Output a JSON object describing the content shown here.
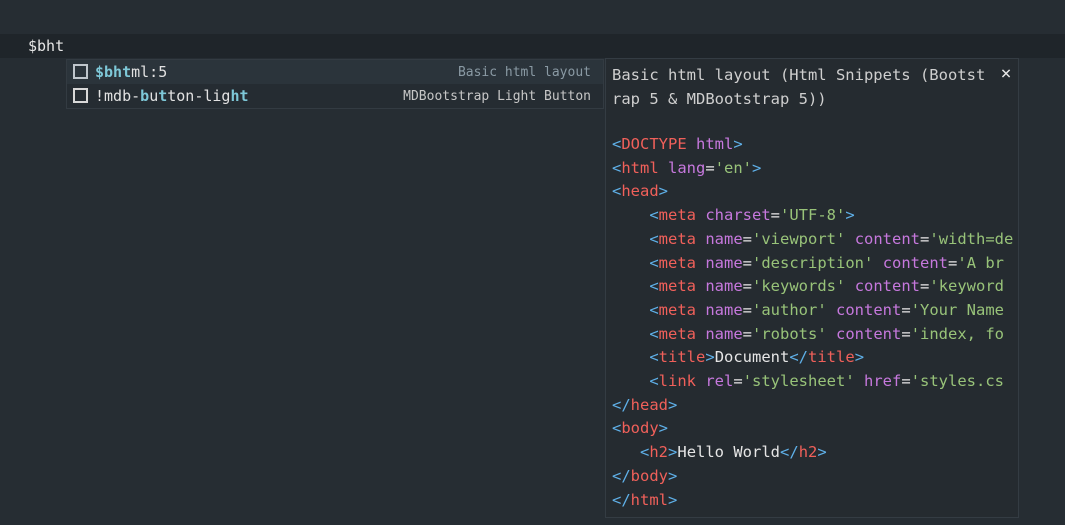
{
  "editor": {
    "text": "$bht"
  },
  "suggestions": [
    {
      "label_match": "$bht",
      "label_rest": "ml:5",
      "detail": "Basic html layout"
    },
    {
      "label_pre": "!mdb-",
      "label_match_1": "b",
      "label_mid": "u",
      "label_match_2": "t",
      "label_mid2": "ton-lig",
      "label_match_3": "ht",
      "detail": "MDBootstrap Light Button"
    }
  ],
  "doc": {
    "title": "Basic html layout (Html Snippets (Bootstrap 5 & MDBootstrap 5))",
    "close_label": "×"
  },
  "code_lines": [
    [
      [
        "p",
        "<"
      ],
      [
        "t",
        "DOCTYPE"
      ],
      [
        "x",
        " "
      ],
      [
        "a",
        "html"
      ],
      [
        "p",
        ">"
      ]
    ],
    [
      [
        "p",
        "<"
      ],
      [
        "t",
        "html"
      ],
      [
        "x",
        " "
      ],
      [
        "a",
        "lang"
      ],
      [
        "x",
        "="
      ],
      [
        "s",
        "'en'"
      ],
      [
        "p",
        ">"
      ]
    ],
    [
      [
        "p",
        "<"
      ],
      [
        "t",
        "head"
      ],
      [
        "p",
        ">"
      ]
    ],
    [
      [
        "x",
        "    "
      ],
      [
        "p",
        "<"
      ],
      [
        "t",
        "meta"
      ],
      [
        "x",
        " "
      ],
      [
        "a",
        "charset"
      ],
      [
        "x",
        "="
      ],
      [
        "s",
        "'UTF-8'"
      ],
      [
        "p",
        ">"
      ]
    ],
    [
      [
        "x",
        "    "
      ],
      [
        "p",
        "<"
      ],
      [
        "t",
        "meta"
      ],
      [
        "x",
        " "
      ],
      [
        "a",
        "name"
      ],
      [
        "x",
        "="
      ],
      [
        "s",
        "'viewport'"
      ],
      [
        "x",
        " "
      ],
      [
        "a",
        "content"
      ],
      [
        "x",
        "="
      ],
      [
        "s",
        "'width=de"
      ]
    ],
    [
      [
        "x",
        "    "
      ],
      [
        "p",
        "<"
      ],
      [
        "t",
        "meta"
      ],
      [
        "x",
        " "
      ],
      [
        "a",
        "name"
      ],
      [
        "x",
        "="
      ],
      [
        "s",
        "'description'"
      ],
      [
        "x",
        " "
      ],
      [
        "a",
        "content"
      ],
      [
        "x",
        "="
      ],
      [
        "s",
        "'A br"
      ]
    ],
    [
      [
        "x",
        "    "
      ],
      [
        "p",
        "<"
      ],
      [
        "t",
        "meta"
      ],
      [
        "x",
        " "
      ],
      [
        "a",
        "name"
      ],
      [
        "x",
        "="
      ],
      [
        "s",
        "'keywords'"
      ],
      [
        "x",
        " "
      ],
      [
        "a",
        "content"
      ],
      [
        "x",
        "="
      ],
      [
        "s",
        "'keyword"
      ]
    ],
    [
      [
        "x",
        "    "
      ],
      [
        "p",
        "<"
      ],
      [
        "t",
        "meta"
      ],
      [
        "x",
        " "
      ],
      [
        "a",
        "name"
      ],
      [
        "x",
        "="
      ],
      [
        "s",
        "'author'"
      ],
      [
        "x",
        " "
      ],
      [
        "a",
        "content"
      ],
      [
        "x",
        "="
      ],
      [
        "s",
        "'Your Name"
      ]
    ],
    [
      [
        "x",
        "    "
      ],
      [
        "p",
        "<"
      ],
      [
        "t",
        "meta"
      ],
      [
        "x",
        " "
      ],
      [
        "a",
        "name"
      ],
      [
        "x",
        "="
      ],
      [
        "s",
        "'robots'"
      ],
      [
        "x",
        " "
      ],
      [
        "a",
        "content"
      ],
      [
        "x",
        "="
      ],
      [
        "s",
        "'index, fo"
      ]
    ],
    [
      [
        "x",
        "    "
      ],
      [
        "p",
        "<"
      ],
      [
        "t",
        "title"
      ],
      [
        "p",
        ">"
      ],
      [
        "x",
        "Document"
      ],
      [
        "p",
        "</"
      ],
      [
        "t",
        "title"
      ],
      [
        "p",
        ">"
      ]
    ],
    [
      [
        "x",
        "    "
      ],
      [
        "p",
        "<"
      ],
      [
        "t",
        "link"
      ],
      [
        "x",
        " "
      ],
      [
        "a",
        "rel"
      ],
      [
        "x",
        "="
      ],
      [
        "s",
        "'stylesheet'"
      ],
      [
        "x",
        " "
      ],
      [
        "a",
        "href"
      ],
      [
        "x",
        "="
      ],
      [
        "s",
        "'styles.cs"
      ]
    ],
    [
      [
        "p",
        "</"
      ],
      [
        "t",
        "head"
      ],
      [
        "p",
        ">"
      ]
    ],
    [
      [
        "p",
        "<"
      ],
      [
        "t",
        "body"
      ],
      [
        "p",
        ">"
      ]
    ],
    [
      [
        "x",
        "   "
      ],
      [
        "p",
        "<"
      ],
      [
        "t",
        "h2"
      ],
      [
        "p",
        ">"
      ],
      [
        "x",
        "Hello World"
      ],
      [
        "p",
        "</"
      ],
      [
        "t",
        "h2"
      ],
      [
        "p",
        ">"
      ]
    ],
    [
      [
        "p",
        "</"
      ],
      [
        "t",
        "body"
      ],
      [
        "p",
        ">"
      ]
    ],
    [
      [
        "p",
        "</"
      ],
      [
        "t",
        "html"
      ],
      [
        "p",
        ">"
      ]
    ]
  ]
}
